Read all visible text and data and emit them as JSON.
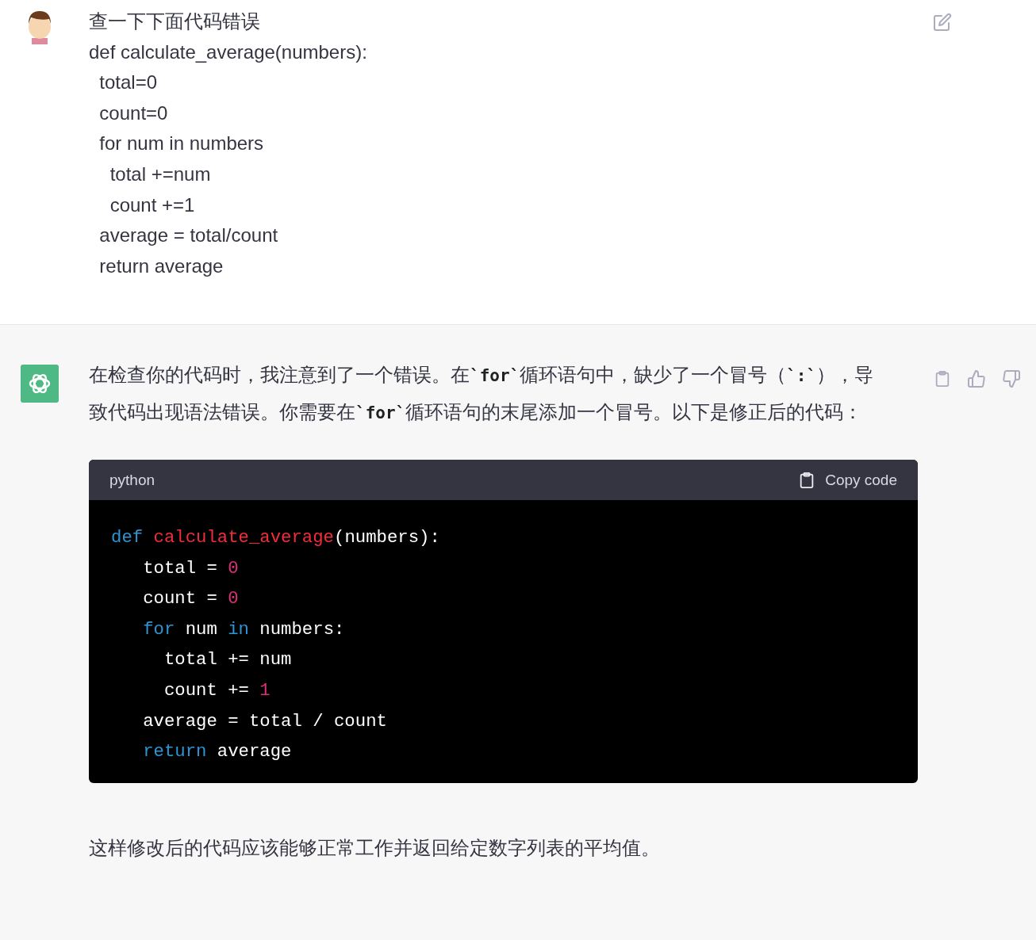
{
  "user_message": {
    "lines": [
      "查一下下面代码错误",
      "def calculate_average(numbers):",
      "  total=0",
      "  count=0",
      "  for num in numbers",
      "    total +=num",
      "    count +=1",
      "  average = total/count",
      "  return average"
    ]
  },
  "assistant_message": {
    "paragraphs": [
      [
        {
          "kind": "text",
          "text": "在检查你的代码时，我注意到了一个错误。在"
        },
        {
          "kind": "code",
          "text": "`for`"
        },
        {
          "kind": "text",
          "text": "循环语句中，缺少了一个冒号（"
        },
        {
          "kind": "code",
          "text": "`:`"
        },
        {
          "kind": "text",
          "text": "），导致代码出现语法错误。你需要在"
        },
        {
          "kind": "code",
          "text": "`for`"
        },
        {
          "kind": "text",
          "text": "循环语句的末尾添加一个冒号。以下是修正后的代码："
        }
      ]
    ],
    "code_block": {
      "language": "python",
      "copy_label": "Copy code",
      "lines": [
        [
          {
            "kind": "keyword",
            "text": "def"
          },
          {
            "kind": "function",
            "text": " calculate_average"
          },
          {
            "kind": "plain",
            "text": "(numbers):"
          }
        ],
        [
          {
            "kind": "plain",
            "text": "   total = "
          },
          {
            "kind": "number",
            "text": "0"
          }
        ],
        [
          {
            "kind": "plain",
            "text": "   count = "
          },
          {
            "kind": "number",
            "text": "0"
          }
        ],
        [
          {
            "kind": "keyword",
            "text": "   for"
          },
          {
            "kind": "plain",
            "text": " num "
          },
          {
            "kind": "keyword",
            "text": "in"
          },
          {
            "kind": "plain",
            "text": " numbers:"
          }
        ],
        [
          {
            "kind": "plain",
            "text": "     total += num"
          }
        ],
        [
          {
            "kind": "plain",
            "text": "     count += "
          },
          {
            "kind": "number",
            "text": "1"
          }
        ],
        [
          {
            "kind": "plain",
            "text": "   average = total / count"
          }
        ],
        [
          {
            "kind": "keyword",
            "text": "   return"
          },
          {
            "kind": "plain",
            "text": " average"
          }
        ]
      ]
    },
    "closing": "这样修改后的代码应该能够正常工作并返回给定数字列表的平均值。"
  }
}
